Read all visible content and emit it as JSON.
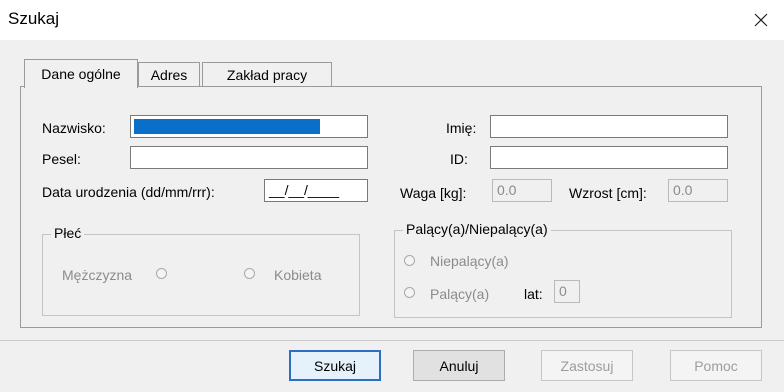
{
  "window": {
    "title": "Szukaj",
    "close_icon": "close-icon"
  },
  "tabs": [
    {
      "label": "Dane ogólne",
      "active": true
    },
    {
      "label": "Adres",
      "active": false
    },
    {
      "label": "Zakład pracy",
      "active": false
    }
  ],
  "form": {
    "nazwisko_label": "Nazwisko:",
    "nazwisko_value": "",
    "imie_label": "Imię:",
    "imie_value": "",
    "pesel_label": "Pesel:",
    "pesel_value": "",
    "id_label": "ID:",
    "id_value": "",
    "data_label": "Data urodzenia (dd/mm/rrr):",
    "data_value": "__/__/____",
    "waga_label": "Waga [kg]:",
    "waga_value": "0.0",
    "wzrost_label": "Wzrost [cm]:",
    "wzrost_value": "0.0"
  },
  "plec": {
    "legend": "Płeć",
    "mezczyzna_label": "Mężczyzna",
    "kobieta_label": "Kobieta"
  },
  "palacy": {
    "legend": "Palący(a)/Niepalący(a)",
    "niepalacy_label": "Niepalący(a)",
    "palacy_label": "Palący(a)",
    "lat_label": "lat:",
    "lat_value": "0"
  },
  "buttons": {
    "szukaj": "Szukaj",
    "anuluj": "Anuluj",
    "zastosuj": "Zastosuj",
    "pomoc": "Pomoc"
  },
  "colors": {
    "selection": "#0a6fc8",
    "default_button_border": "#2c6fc0"
  }
}
